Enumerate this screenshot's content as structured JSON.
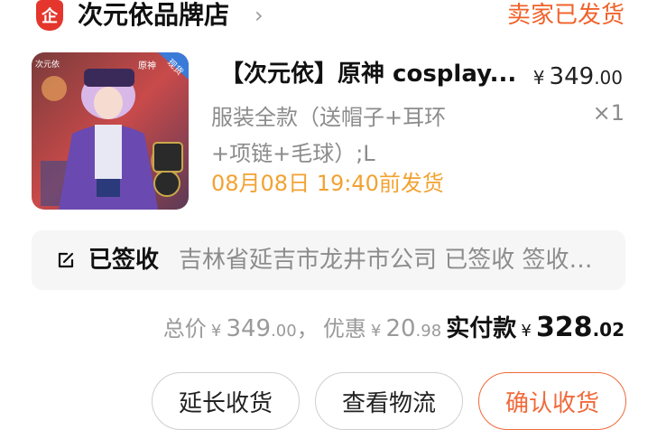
{
  "header": {
    "store_badge": "企",
    "store_name": "次元依品牌店",
    "chevron": "›",
    "order_status": "卖家已发货"
  },
  "product": {
    "image_label_brand": "次元依",
    "image_label_game": "原神",
    "image_label_tag": "现货",
    "title": "【次元依】原神 cosplay...",
    "sku_line1": "服装全款（送帽子+耳环",
    "sku_line2": "+项链+毛球）;L",
    "price_currency": "¥",
    "price_int": "349",
    "price_dec": ".00",
    "quantity": "×1",
    "ship_note": "08月08日 19:40前发货"
  },
  "logistics": {
    "status": "已签收",
    "detail": "吉林省延吉市龙井市公司 已签收 签收…"
  },
  "totals": {
    "total_label": "总价",
    "total_currency": "¥",
    "total_int": "349",
    "total_dec": ".00",
    "separator": "，",
    "discount_label": "优惠",
    "discount_currency": "¥",
    "discount_int": "20",
    "discount_dec": ".98",
    "paid_label": "实付款",
    "paid_currency": "¥",
    "paid_int": "328",
    "paid_dec": ".02"
  },
  "actions": {
    "extend_label": "延长收货",
    "logistics_label": "查看物流",
    "confirm_label": "确认收货"
  },
  "colors": {
    "accent": "#f0622a",
    "ship_note": "#f2a232",
    "badge": "#e4362c"
  }
}
